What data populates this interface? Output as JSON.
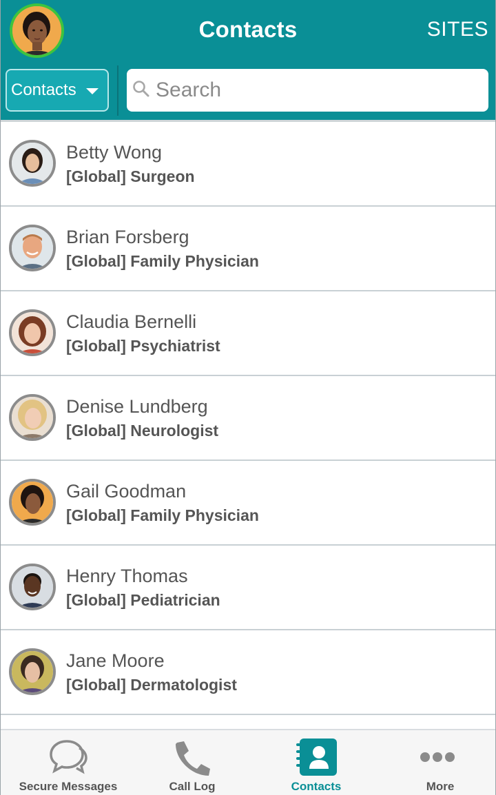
{
  "header": {
    "title": "Contacts",
    "sites_label": "SITES"
  },
  "filter": {
    "label": "Contacts"
  },
  "search": {
    "placeholder": "Search"
  },
  "contacts": [
    {
      "name": "Betty Wong",
      "role": "[Global] Surgeon"
    },
    {
      "name": "Brian Forsberg",
      "role": "[Global] Family Physician"
    },
    {
      "name": "Claudia Bernelli",
      "role": "[Global] Psychiatrist"
    },
    {
      "name": "Denise Lundberg",
      "role": "[Global] Neurologist"
    },
    {
      "name": "Gail Goodman",
      "role": "[Global] Family Physician"
    },
    {
      "name": "Henry Thomas",
      "role": "[Global] Pediatrician"
    },
    {
      "name": "Jane Moore",
      "role": "[Global] Dermatologist"
    }
  ],
  "tabs": [
    {
      "label": "Secure Messages",
      "icon": "chat-bubbles-icon",
      "active": false
    },
    {
      "label": "Call Log",
      "icon": "phone-icon",
      "active": false
    },
    {
      "label": "Contacts",
      "icon": "contacts-book-icon",
      "active": true
    },
    {
      "label": "More",
      "icon": "more-dots-icon",
      "active": false
    }
  ],
  "colors": {
    "brand_teal": "#0a8f96",
    "filter_button": "#17a9b2",
    "avatar_ring_online": "#3ec43e",
    "avatar_ring": "#8c8c8c",
    "text_gray": "#555555"
  }
}
